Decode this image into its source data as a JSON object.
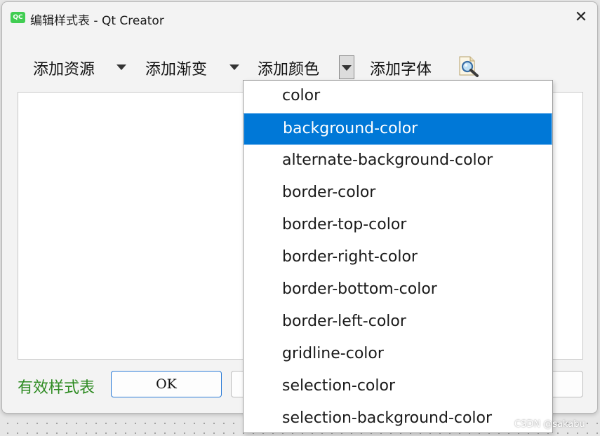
{
  "window": {
    "app_icon_text": "QC",
    "title": "编辑样式表 - Qt Creator",
    "close_glyph": "✕"
  },
  "toolbar": {
    "add_resource": "添加资源",
    "add_gradient": "添加渐变",
    "add_color": "添加颜色",
    "add_font": "添加字体",
    "icons": [
      "chevron-down-icon",
      "chevron-down-icon",
      "chevron-down-icon",
      "magnifier-icon"
    ]
  },
  "status": {
    "valid_label": "有效样式表",
    "valid_color": "#2e8b22"
  },
  "buttons": {
    "ok": "OK"
  },
  "color_menu": {
    "selected_index": 1,
    "accent": "#0078d7",
    "items": [
      "color",
      "background-color",
      "alternate-background-color",
      "border-color",
      "border-top-color",
      "border-right-color",
      "border-bottom-color",
      "border-left-color",
      "gridline-color",
      "selection-color",
      "selection-background-color"
    ]
  },
  "watermark": "CSDN @sakabu"
}
